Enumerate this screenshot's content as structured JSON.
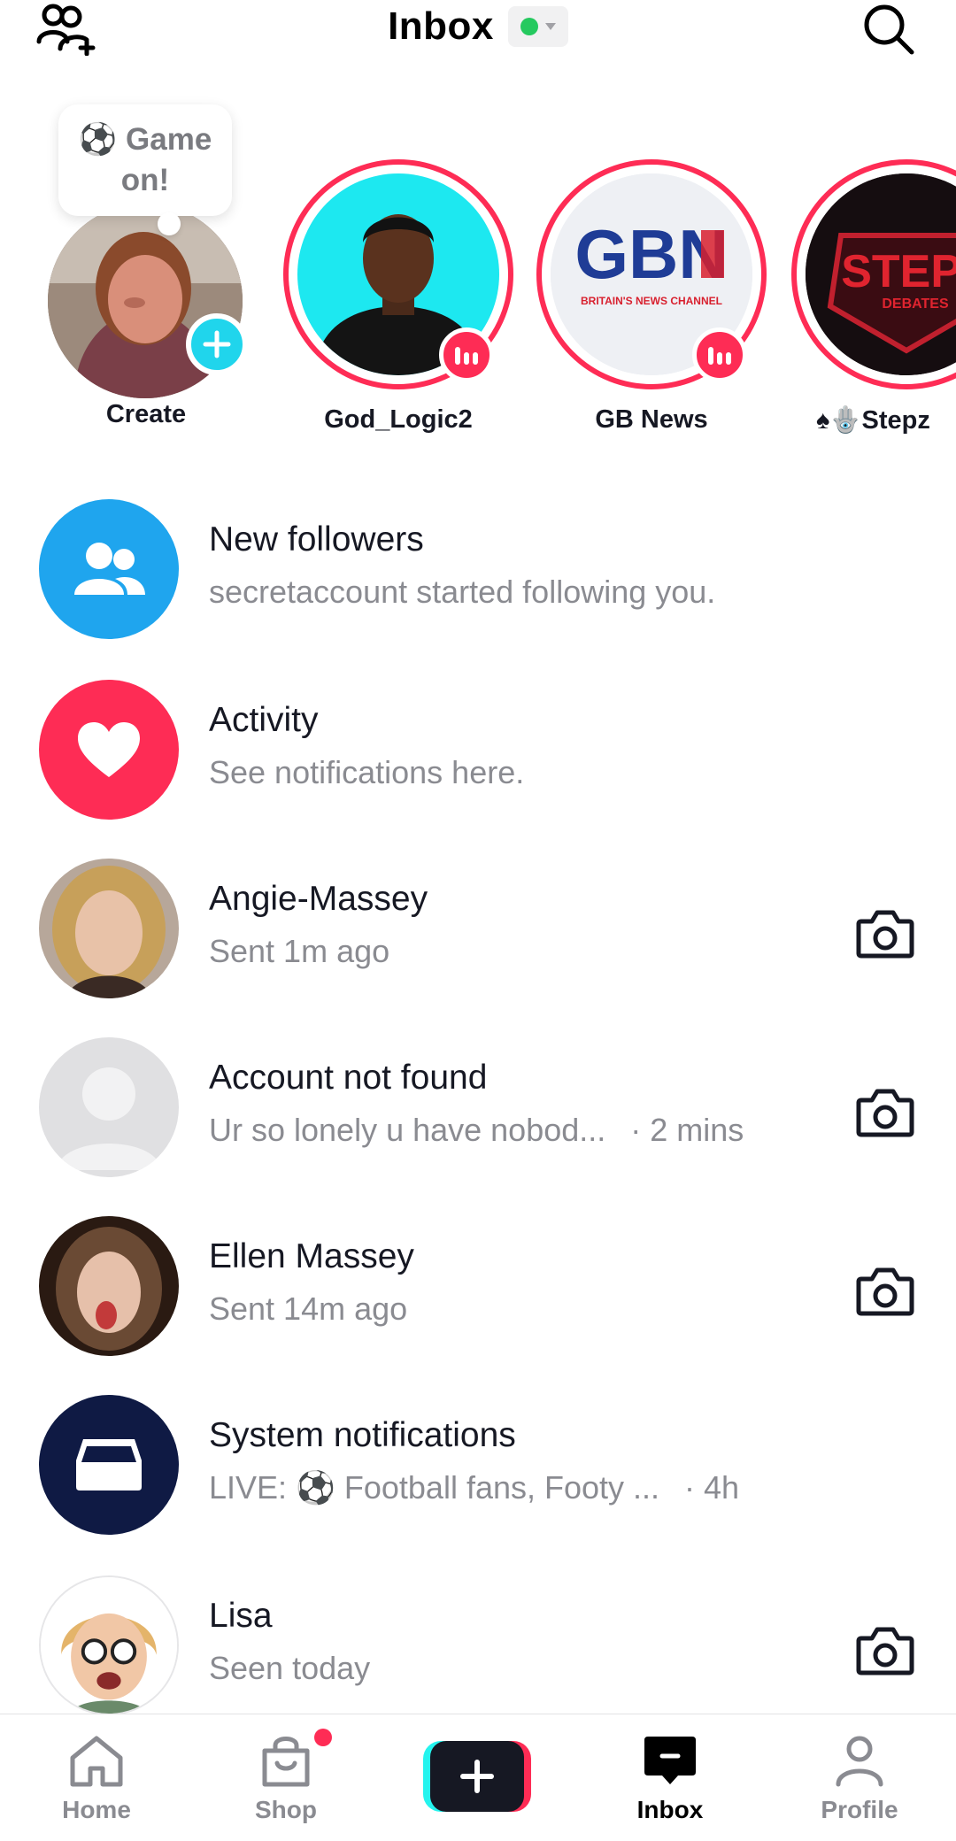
{
  "header": {
    "title": "Inbox",
    "status_color": "#25c95f",
    "left_icon": "add-friends-icon",
    "right_icon": "search-icon"
  },
  "stories": {
    "create": {
      "bubble_text": "⚽ Game on!",
      "label": "Create"
    },
    "items": [
      {
        "name": "God_Logic2"
      },
      {
        "name": "GB News",
        "avatar_text": "GBN",
        "avatar_subtext": "BRITAIN'S NEWS CHANNEL"
      },
      {
        "name": "♠🪬Stepz",
        "avatar_text": "STEPZ",
        "avatar_subtext": "DEBATES"
      }
    ]
  },
  "inbox": [
    {
      "title": "New followers",
      "subtitle": "secretaccount started following you.",
      "icon": "followers-icon",
      "color": "#1fa5ee"
    },
    {
      "title": "Activity",
      "subtitle": "See notifications here.",
      "icon": "heart-icon",
      "color": "#fe2c55"
    },
    {
      "title": "Angie-Massey",
      "subtitle": "Sent 1m ago",
      "camera": true
    },
    {
      "title": "Account not found",
      "subtitle": "Ur so lonely u have nobod...",
      "time": "· 2 mins",
      "camera": true
    },
    {
      "title": "Ellen Massey",
      "subtitle": "Sent 14m ago",
      "camera": true
    },
    {
      "title": "System notifications",
      "subtitle": "LIVE: ⚽ Football fans, Footy ...",
      "time": "· 4h",
      "icon": "inbox-tray-icon",
      "color": "#0f1a44"
    },
    {
      "title": "Lisa",
      "subtitle": "Seen today",
      "camera": true
    }
  ],
  "nav": {
    "items": [
      {
        "label": "Home"
      },
      {
        "label": "Shop"
      },
      {
        "label": "Inbox"
      },
      {
        "label": "Profile"
      }
    ],
    "active": "Inbox"
  },
  "colors": {
    "accent_red": "#fe2c55",
    "accent_cyan": "#25f4ee",
    "text_primary": "#161823",
    "text_secondary": "#8a8b91"
  }
}
